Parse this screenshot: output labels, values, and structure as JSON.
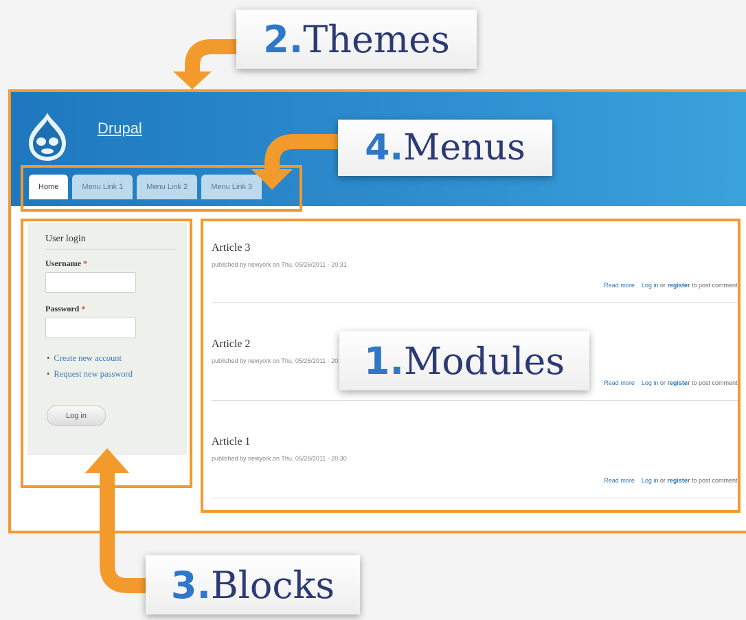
{
  "site": {
    "name": "Drupal",
    "menu": [
      "Home",
      "Menu Link 1",
      "Menu Link 2",
      "Menu Link 3"
    ]
  },
  "login": {
    "title": "User login",
    "username_label": "Username",
    "password_label": "Password",
    "required_mark": "*",
    "links": [
      "Create new account",
      "Request new password"
    ],
    "button": "Log in"
  },
  "articles": [
    {
      "title": "Article 3",
      "meta": "published by newyork on Thu, 05/26/2011 - 20:31"
    },
    {
      "title": "Article 2",
      "meta": "published by newyork on Thu, 05/26/2011 - 20:30"
    },
    {
      "title": "Article 1",
      "meta": "published by newyork on Thu, 05/26/2011 - 20:30"
    }
  ],
  "article_links": {
    "read_more": "Read more",
    "log_in": "Log in",
    "or": "or",
    "register": "register",
    "suffix": "to post comments"
  },
  "callouts": {
    "themes": {
      "num": "2.",
      "label": "Themes"
    },
    "menus": {
      "num": "4.",
      "label": "Menus"
    },
    "modules": {
      "num": "1.",
      "label": "Modules"
    },
    "blocks": {
      "num": "3.",
      "label": "Blocks"
    }
  },
  "colors": {
    "annotation_orange": "#f39a2c",
    "callout_number_blue": "#2f78c8",
    "header_blue": "#2f8fd0"
  }
}
